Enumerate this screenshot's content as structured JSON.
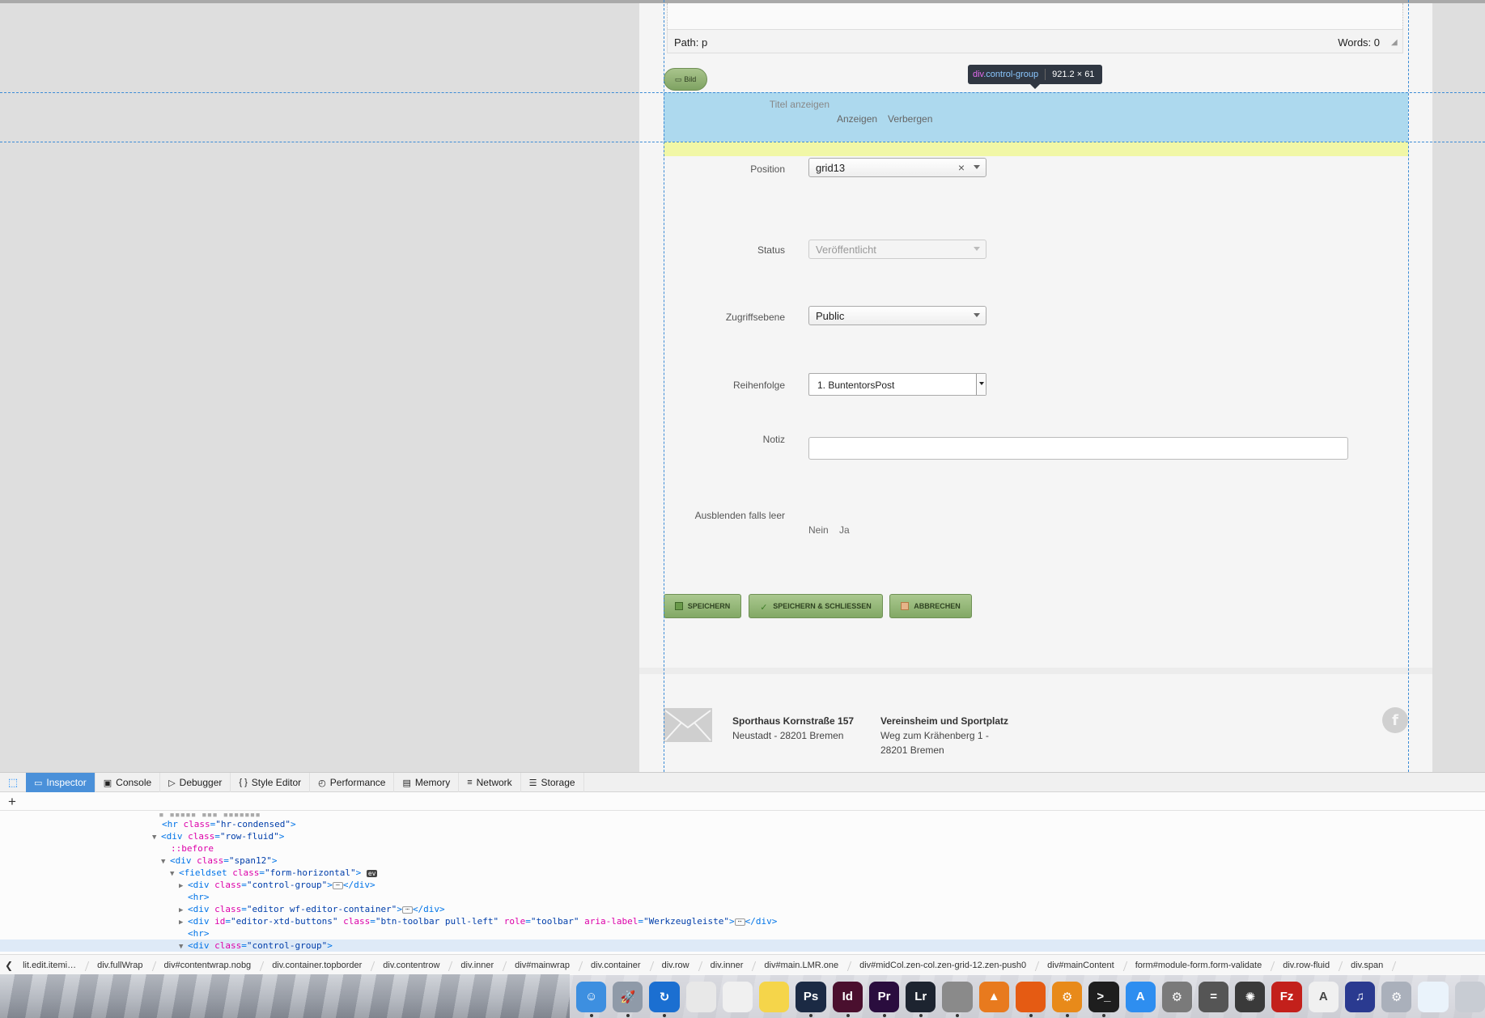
{
  "editor": {
    "path_label": "Path: p",
    "words_label": "Words: 0"
  },
  "bild_button": {
    "label": "Bild"
  },
  "tooltip": {
    "tag": "div",
    "class": ".control-group",
    "size": "921.2 × 61"
  },
  "form": {
    "titel": {
      "label": "Titel anzeigen",
      "options": [
        "Anzeigen",
        "Verbergen"
      ]
    },
    "position": {
      "label": "Position",
      "value": "grid13",
      "clear": "×"
    },
    "status": {
      "label": "Status",
      "value": "Veröffentlicht"
    },
    "zugriffsebene": {
      "label": "Zugriffsebene",
      "value": "Public"
    },
    "reihenfolge": {
      "label": "Reihenfolge",
      "value": "1. BuntentorsPost"
    },
    "notiz": {
      "label": "Notiz",
      "value": ""
    },
    "ausblenden": {
      "label": "Ausblenden falls leer",
      "options": [
        "Nein",
        "Ja"
      ]
    }
  },
  "actions": {
    "save": "Speichern",
    "save_close": "Speichern & Schliessen",
    "cancel": "Abbrechen"
  },
  "footer": {
    "col1": {
      "title": "Sporthaus Kornstraße 157",
      "line1": "Neustadt - 28201 Bremen"
    },
    "col2": {
      "title": "Vereinsheim und Sportplatz",
      "line1": "Weg zum Krähenberg 1 -",
      "line2": "28201 Bremen"
    },
    "facebook": "f"
  },
  "devtools": {
    "tabs": [
      {
        "label": "Inspector",
        "icon": "inspector-icon",
        "glyph": "▭"
      },
      {
        "label": "Console",
        "icon": "console-icon",
        "glyph": "▣"
      },
      {
        "label": "Debugger",
        "icon": "debugger-icon",
        "glyph": "▷"
      },
      {
        "label": "Style Editor",
        "icon": "style-editor-icon",
        "glyph": "{ }"
      },
      {
        "label": "Performance",
        "icon": "performance-icon",
        "glyph": "◴"
      },
      {
        "label": "Memory",
        "icon": "memory-icon",
        "glyph": "▤"
      },
      {
        "label": "Network",
        "icon": "network-icon",
        "glyph": "≡"
      },
      {
        "label": "Storage",
        "icon": "storage-icon",
        "glyph": "☰"
      }
    ],
    "active_tab": "Inspector",
    "add_node": "+",
    "breadcrumbs": [
      "lit.edit.itemi…",
      "div.fullWrap",
      "div#contentwrap.nobg",
      "div.container.topborder",
      "div.contentrow",
      "div.inner",
      "div#mainwrap",
      "div.container",
      "div.row",
      "div.inner",
      "div#main.LMR.one",
      "div#midCol.zen-col.zen-grid-12.zen-push0",
      "div#mainContent",
      "form#module-form.form-validate",
      "div.row-fluid",
      "div.span"
    ],
    "tree": {
      "l1": {
        "tag": "hr",
        "attr": "class",
        "val": "\"hr-condensed\""
      },
      "l2": {
        "tag": "div",
        "attr": "class",
        "val": "\"row-fluid\""
      },
      "l3": {
        "pseudo": "::before"
      },
      "l4": {
        "tag": "div",
        "attr": "class",
        "val": "\"span12\""
      },
      "l5": {
        "tag": "fieldset",
        "attr": "class",
        "val": "\"form-horizontal\"",
        "badge": "ev"
      },
      "l6": {
        "tag": "div",
        "attr": "class",
        "val": "\"control-group\"",
        "close": "</div>",
        "ell": "⋯"
      },
      "l7": {
        "tag": "hr"
      },
      "l8": {
        "tag": "div",
        "attr": "class",
        "val": "\"editor wf-editor-container\"",
        "close": "</div>",
        "ell": "⋯"
      },
      "l9": {
        "tag": "div",
        "a1": "id",
        "v1": "\"editor-xtd-buttons\"",
        "a2": "class",
        "v2": "\"btn-toolbar pull-left\"",
        "a3": "role",
        "v3": "\"toolbar\"",
        "a4": "aria-label",
        "v4": "\"Werkzeugleiste\"",
        "close": "</div>",
        "ell": "⋯"
      },
      "l10": {
        "tag": "hr"
      },
      "l11": {
        "tag": "div",
        "attr": "class",
        "val": "\"control-group\""
      }
    }
  },
  "dock": [
    {
      "name": "finder-icon",
      "color": "#3d8fe0",
      "glyph": "☺"
    },
    {
      "name": "launchpad-icon",
      "color": "#8f9aa8",
      "glyph": "🚀"
    },
    {
      "name": "sync-icon",
      "color": "#1b6fd1",
      "glyph": "↻"
    },
    {
      "name": "preview-icon",
      "color": "#e8e8e8",
      "glyph": ""
    },
    {
      "name": "textedit-icon",
      "color": "#f0f0f0",
      "glyph": ""
    },
    {
      "name": "notes-icon",
      "color": "#f5d54a",
      "glyph": ""
    },
    {
      "name": "photoshop-icon",
      "color": "#1b2a44",
      "glyph": "Ps"
    },
    {
      "name": "indesign-icon",
      "color": "#4a0f2e",
      "glyph": "Id"
    },
    {
      "name": "premiere-icon",
      "color": "#2a0d3e",
      "glyph": "Pr"
    },
    {
      "name": "lightroom-icon",
      "color": "#1d2430",
      "glyph": "Lr"
    },
    {
      "name": "script-editor-icon",
      "color": "#8a8a8a",
      "glyph": ""
    },
    {
      "name": "vlc-icon",
      "color": "#e87a1e",
      "glyph": "▲"
    },
    {
      "name": "firefox-icon",
      "color": "#e55b13",
      "glyph": ""
    },
    {
      "name": "settings-gear-icon",
      "color": "#e88a1a",
      "glyph": "⚙"
    },
    {
      "name": "terminal-icon",
      "color": "#1e1e1e",
      "glyph": ">_"
    },
    {
      "name": "app-store-icon",
      "color": "#2e8ef0",
      "glyph": "A"
    },
    {
      "name": "system-preferences-icon",
      "color": "#7a7a7a",
      "glyph": "⚙"
    },
    {
      "name": "calculator-icon",
      "color": "#555555",
      "glyph": "="
    },
    {
      "name": "aperture-icon",
      "color": "#3a3a3a",
      "glyph": "✺"
    },
    {
      "name": "filezilla-icon",
      "color": "#c3201b",
      "glyph": "Fz"
    },
    {
      "name": "acrobat-icon",
      "color": "#f0f0f0",
      "glyph": "A"
    },
    {
      "name": "audacity-icon",
      "color": "#2a3a90",
      "glyph": "♫"
    },
    {
      "name": "system-info-icon",
      "color": "#aab0bb",
      "glyph": "⚙"
    },
    {
      "name": "documents-icon",
      "color": "#eaf3fb",
      "glyph": ""
    },
    {
      "name": "trash-icon",
      "color": "#c8ccd3",
      "glyph": ""
    }
  ],
  "colors": {
    "highlight_blue": "#add9ee",
    "highlight_yellow": "#f1f7a6",
    "button_green": "#82a865",
    "devtools_active": "#4a90d9",
    "guide_line": "#3b8bd6"
  }
}
